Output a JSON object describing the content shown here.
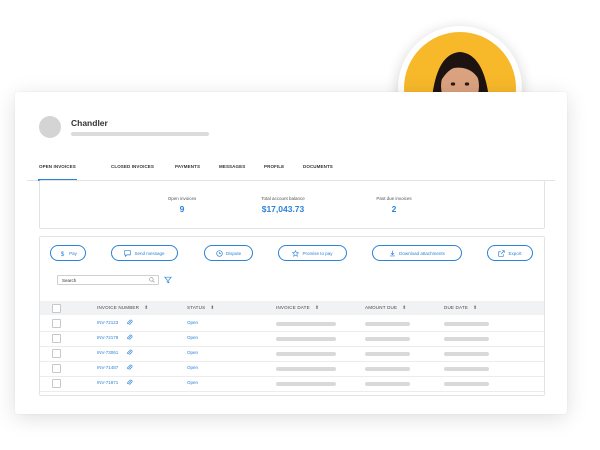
{
  "user": {
    "name": "Chandler"
  },
  "tabs": [
    {
      "label": "OPEN INVOICES",
      "active": true
    },
    {
      "label": "CLOSED INVOICES"
    },
    {
      "label": "PAYMENTS"
    },
    {
      "label": "MESSAGES"
    },
    {
      "label": "PROFILE"
    },
    {
      "label": "DOCUMENTS"
    }
  ],
  "summary": [
    {
      "label": "Open invoices",
      "value": "9"
    },
    {
      "label": "Total account balance",
      "value": "$17,043.73"
    },
    {
      "label": "Past due invoices",
      "value": "2"
    }
  ],
  "actions": [
    {
      "label": "Pay",
      "icon": "dollar-icon"
    },
    {
      "label": "Send message",
      "icon": "message-icon"
    },
    {
      "label": "Dispute",
      "icon": "clock-icon"
    },
    {
      "label": "Promise to pay",
      "icon": "star-icon"
    },
    {
      "label": "Download attachments",
      "icon": "download-icon"
    },
    {
      "label": "Export",
      "icon": "export-icon"
    }
  ],
  "search": {
    "value": "Search"
  },
  "table": {
    "headers": [
      "INVOICE NUMBER",
      "STATUS",
      "INVOICE DATE",
      "AMOUNT DUE",
      "DUE DATE"
    ],
    "rows": [
      {
        "invoice": "INV-72123",
        "status": "Open"
      },
      {
        "invoice": "INV-72178",
        "status": "Open"
      },
      {
        "invoice": "INV-73061",
        "status": "Open"
      },
      {
        "invoice": "INV-71487",
        "status": "Open"
      },
      {
        "invoice": "INV-71871",
        "status": "Open"
      }
    ]
  },
  "colors": {
    "accent": "#2d83d6",
    "photo_bg": "#f7b82a"
  }
}
